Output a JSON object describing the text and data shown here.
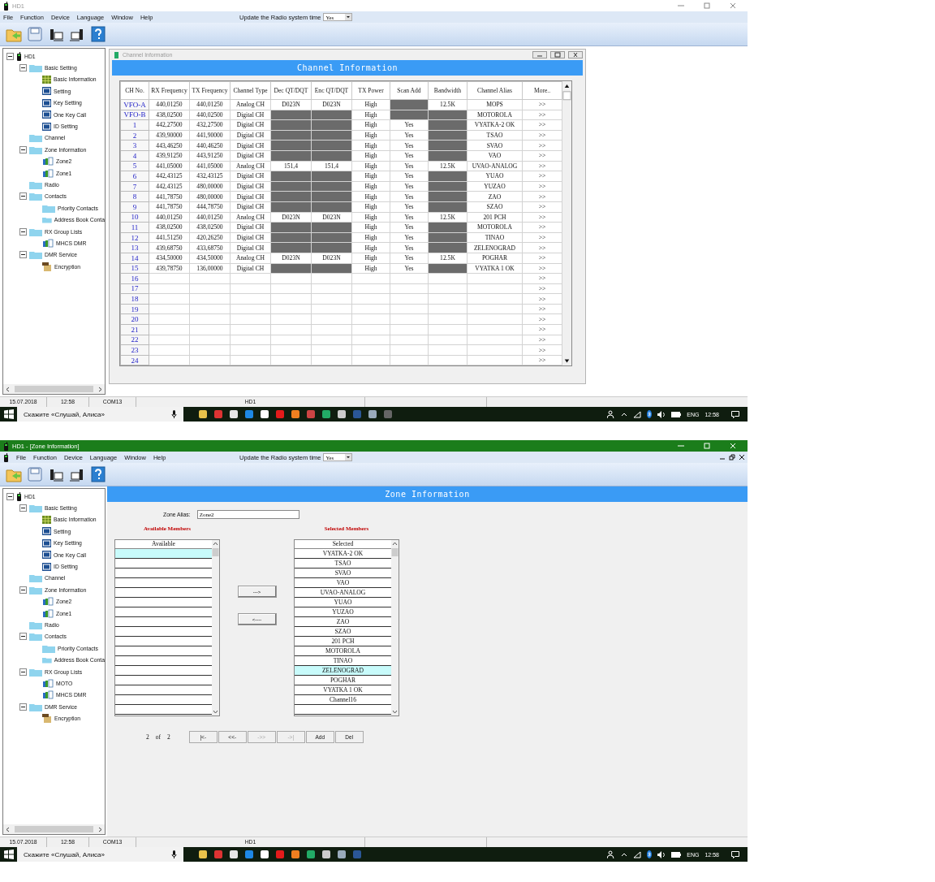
{
  "screens": [
    {
      "kind": "channels",
      "title_bar": {
        "title": "HD1",
        "active": false
      },
      "child_maximized": false,
      "menu": [
        "File",
        "Function",
        "Device",
        "Language",
        "Window",
        "Help"
      ],
      "sync": {
        "label": "Update the Radio system time",
        "value": "Yes"
      },
      "tree": [
        {
          "label": "HD1",
          "kind": "radio",
          "expanded": true,
          "children": [
            {
              "label": "Basic Setting",
              "kind": "folder",
              "expanded": true,
              "children": [
                {
                  "label": "Basic Information",
                  "kind": "grid"
                },
                {
                  "label": "Setting",
                  "kind": "set"
                },
                {
                  "label": "Key Setting",
                  "kind": "set"
                },
                {
                  "label": "One Key Call",
                  "kind": "set"
                },
                {
                  "label": "ID Setting",
                  "kind": "set"
                }
              ]
            },
            {
              "label": "Channel",
              "kind": "folder"
            },
            {
              "label": "Zone Information",
              "kind": "folder",
              "expanded": true,
              "children": [
                {
                  "label": "Zone2",
                  "kind": "zone"
                },
                {
                  "label": "Zone1",
                  "kind": "zone"
                }
              ]
            },
            {
              "label": "Radio",
              "kind": "folder"
            },
            {
              "label": "Contacts",
              "kind": "folder",
              "expanded": true,
              "children": [
                {
                  "label": "Priority Contacts",
                  "kind": "folder"
                },
                {
                  "label": "Address Book Conta",
                  "kind": "folder"
                }
              ]
            },
            {
              "label": "RX Group Lists",
              "kind": "folder",
              "expanded": true,
              "children": [
                {
                  "label": "MHCS DMR",
                  "kind": "zone"
                }
              ]
            },
            {
              "label": "DMR Service",
              "kind": "folder",
              "expanded": true,
              "children": [
                {
                  "label": "Encryption",
                  "kind": "key"
                }
              ]
            }
          ]
        }
      ],
      "child_window": {
        "title": "Channel Information",
        "header": "Channel Information",
        "columns": [
          "CH No.",
          "RX Frequency",
          "TX Frequency",
          "Channel Type",
          "Dec QT/DQT",
          "Enc QT/DQT",
          "TX Power",
          "Scan Add",
          "Bandwidth",
          "Channel Alias",
          "More.."
        ],
        "rows": [
          {
            "ch": "VFO-A",
            "cells": [
              "440,01250",
              "440,01250",
              "Analog CH",
              "D023N",
              "D023N",
              "High",
              null,
              "12.5K",
              "MOPS"
            ],
            "more": ">>"
          },
          {
            "ch": "VFO-B",
            "cells": [
              "438,02500",
              "440,02500",
              "Digital CH",
              null,
              null,
              "High",
              null,
              null,
              "MOTOROLA"
            ],
            "more": ">>"
          },
          {
            "ch": "1",
            "cells": [
              "442,27500",
              "432,27500",
              "Digital CH",
              null,
              null,
              "High",
              "Yes",
              null,
              "VYATKA-2 OK"
            ],
            "more": ">>"
          },
          {
            "ch": "2",
            "cells": [
              "439,90000",
              "441,90000",
              "Digital CH",
              null,
              null,
              "High",
              "Yes",
              null,
              "TSAO"
            ],
            "more": ">>"
          },
          {
            "ch": "3",
            "cells": [
              "443,46250",
              "440,46250",
              "Digital CH",
              null,
              null,
              "High",
              "Yes",
              null,
              "SVAO"
            ],
            "more": ">>"
          },
          {
            "ch": "4",
            "cells": [
              "439,91250",
              "443,91250",
              "Digital CH",
              null,
              null,
              "High",
              "Yes",
              null,
              "VAO"
            ],
            "more": ">>"
          },
          {
            "ch": "5",
            "cells": [
              "441,05000",
              "441,05000",
              "Analog CH",
              "151,4",
              "151,4",
              "High",
              "Yes",
              "12.5K",
              "UVAO-ANALOG"
            ],
            "more": ">>"
          },
          {
            "ch": "6",
            "cells": [
              "442,43125",
              "432,43125",
              "Digital CH",
              null,
              null,
              "High",
              "Yes",
              null,
              "YUAO"
            ],
            "more": ">>"
          },
          {
            "ch": "7",
            "cells": [
              "442,43125",
              "480,00000",
              "Digital CH",
              null,
              null,
              "High",
              "Yes",
              null,
              "YUZAO"
            ],
            "more": ">>"
          },
          {
            "ch": "8",
            "cells": [
              "441,78750",
              "480,00000",
              "Digital CH",
              null,
              null,
              "High",
              "Yes",
              null,
              "ZAO"
            ],
            "more": ">>"
          },
          {
            "ch": "9",
            "cells": [
              "441,78750",
              "444,78750",
              "Digital CH",
              null,
              null,
              "High",
              "Yes",
              null,
              "SZAO"
            ],
            "more": ">>"
          },
          {
            "ch": "10",
            "cells": [
              "440,01250",
              "440,01250",
              "Analog CH",
              "D023N",
              "D023N",
              "High",
              "Yes",
              "12.5K",
              "201 PCH"
            ],
            "more": ">>"
          },
          {
            "ch": "11",
            "cells": [
              "438,02500",
              "438,02500",
              "Digital CH",
              null,
              null,
              "High",
              "Yes",
              null,
              "MOTOROLA"
            ],
            "more": ">>"
          },
          {
            "ch": "12",
            "cells": [
              "441,51250",
              "420,26250",
              "Digital CH",
              null,
              null,
              "High",
              "Yes",
              null,
              "TINAO"
            ],
            "more": ">>"
          },
          {
            "ch": "13",
            "cells": [
              "439,68750",
              "433,68750",
              "Digital CH",
              null,
              null,
              "High",
              "Yes",
              null,
              "ZELENOGRAD"
            ],
            "more": ">>"
          },
          {
            "ch": "14",
            "cells": [
              "434,50000",
              "434,50000",
              "Analog CH",
              "D023N",
              "D023N",
              "High",
              "Yes",
              "12.5K",
              "POGHAR"
            ],
            "more": ">>"
          },
          {
            "ch": "15",
            "cells": [
              "439,78750",
              "136,00000",
              "Digital CH",
              null,
              null,
              "High",
              "Yes",
              null,
              "VYATKA 1 OK"
            ],
            "more": ">>"
          },
          {
            "ch": "16",
            "more": ">>"
          },
          {
            "ch": "17",
            "more": ">>"
          },
          {
            "ch": "18",
            "more": ">>"
          },
          {
            "ch": "19",
            "more": ">>"
          },
          {
            "ch": "20",
            "more": ">>"
          },
          {
            "ch": "21",
            "more": ">>"
          },
          {
            "ch": "22",
            "more": ">>"
          },
          {
            "ch": "23",
            "more": ">>"
          },
          {
            "ch": "24",
            "more": ">>"
          }
        ]
      },
      "status_bar": [
        "15.07.2018",
        "12:58",
        "COM13",
        "HD1"
      ],
      "taskbar": {
        "search": "Скажите «Слушай, Алиса»",
        "language": "ENG",
        "time": "12:58"
      }
    },
    {
      "kind": "zone",
      "title_bar": {
        "title": "HD1 - [Zone Information]",
        "active": true
      },
      "child_maximized": true,
      "menu": [
        "File",
        "Function",
        "Device",
        "Language",
        "Window",
        "Help"
      ],
      "sync": {
        "label": "Update the Radio system time",
        "value": "Yes"
      },
      "tree": [
        {
          "label": "HD1",
          "kind": "radio",
          "expanded": true,
          "children": [
            {
              "label": "Basic Setting",
              "kind": "folder",
              "expanded": true,
              "children": [
                {
                  "label": "Basic Information",
                  "kind": "grid"
                },
                {
                  "label": "Setting",
                  "kind": "set"
                },
                {
                  "label": "Key Setting",
                  "kind": "set"
                },
                {
                  "label": "One Key Call",
                  "kind": "set"
                },
                {
                  "label": "ID Setting",
                  "kind": "set"
                }
              ]
            },
            {
              "label": "Channel",
              "kind": "folder"
            },
            {
              "label": "Zone Information",
              "kind": "folder",
              "expanded": true,
              "children": [
                {
                  "label": "Zone2",
                  "kind": "zone"
                },
                {
                  "label": "Zone1",
                  "kind": "zone"
                }
              ]
            },
            {
              "label": "Radio",
              "kind": "folder"
            },
            {
              "label": "Contacts",
              "kind": "folder",
              "expanded": true,
              "children": [
                {
                  "label": "Priority Contacts",
                  "kind": "folder"
                },
                {
                  "label": "Address Book Conta",
                  "kind": "folder"
                }
              ]
            },
            {
              "label": "RX Group Lists",
              "kind": "folder",
              "expanded": true,
              "children": [
                {
                  "label": "MOTO",
                  "kind": "zone"
                },
                {
                  "label": "MHCS DMR",
                  "kind": "zone"
                }
              ]
            },
            {
              "label": "DMR Service",
              "kind": "folder",
              "expanded": true,
              "children": [
                {
                  "label": "Encryption",
                  "kind": "key"
                }
              ]
            }
          ]
        }
      ],
      "zone_form": {
        "header": "Zone Information",
        "alias_label": "Zone Alias:",
        "alias_value": "Zone2",
        "available_title": "Available Members",
        "selected_title": "Selected Members",
        "available": {
          "header": "Available",
          "rows": [
            {
              "selected": true
            },
            {
              "selected": false
            },
            {
              "selected": false
            },
            {
              "selected": false
            },
            {
              "selected": false
            },
            {
              "selected": false
            },
            {
              "selected": false
            },
            {
              "selected": false
            },
            {
              "selected": false
            },
            {
              "selected": false
            },
            {
              "selected": false
            },
            {
              "selected": false
            },
            {
              "selected": false
            },
            {
              "selected": false
            },
            {
              "selected": false
            },
            {
              "selected": false
            },
            {
              "selected": false
            }
          ]
        },
        "selected": {
          "header": "Selected",
          "rows": [
            {
              "label": "VYATKA-2 OK",
              "selected": false
            },
            {
              "label": "TSAO",
              "selected": false
            },
            {
              "label": "SVAO",
              "selected": false
            },
            {
              "label": "VAO",
              "selected": false
            },
            {
              "label": "UVAO-ANALOG",
              "selected": false
            },
            {
              "label": "YUAO",
              "selected": false
            },
            {
              "label": "YUZAO",
              "selected": false
            },
            {
              "label": "ZAO",
              "selected": false
            },
            {
              "label": "SZAO",
              "selected": false
            },
            {
              "label": "201 PCH",
              "selected": false
            },
            {
              "label": "MOTOROLA",
              "selected": false
            },
            {
              "label": "TINAO",
              "selected": false
            },
            {
              "label": "ZELENOGRAD",
              "selected": true
            },
            {
              "label": "POGHAR",
              "selected": false
            },
            {
              "label": "VYATKA 1 OK",
              "selected": false
            },
            {
              "label": "Channel16",
              "selected": false
            },
            {
              "selected": false
            }
          ]
        },
        "move_buttons": [
          "--->",
          "<----"
        ],
        "pager": {
          "page": "2",
          "of": "of",
          "total": "2"
        },
        "pager_buttons": [
          {
            "label": "|<-",
            "disabled": false
          },
          {
            "label": "<<-",
            "disabled": false
          },
          {
            "label": "->>",
            "disabled": true
          },
          {
            "label": "->|",
            "disabled": true
          },
          {
            "label": "Add",
            "disabled": false
          },
          {
            "label": "Del",
            "disabled": false
          }
        ]
      },
      "status_bar": [
        "15.07.2018",
        "12:58",
        "COM13",
        "HD1"
      ],
      "taskbar": {
        "search": "Скажите «Слушай, Алиса»",
        "language": "ENG",
        "time": "12:58"
      }
    }
  ]
}
